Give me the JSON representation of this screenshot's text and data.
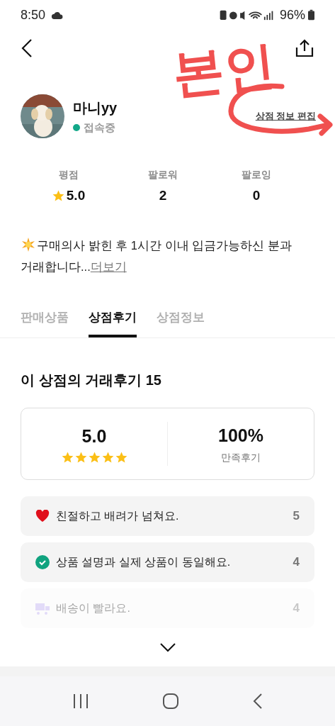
{
  "status_bar": {
    "time": "8:50",
    "battery": "96%"
  },
  "profile": {
    "name": "마니yy",
    "online": true,
    "status": "접속중",
    "edit_link": "상점 정보 편집"
  },
  "annotation": {
    "text": "본인"
  },
  "stats": [
    {
      "label": "평점",
      "value": "5.0",
      "kind": "rating"
    },
    {
      "label": "팔로워",
      "value": "2",
      "kind": "count"
    },
    {
      "label": "팔로잉",
      "value": "0",
      "kind": "count"
    }
  ],
  "bio": {
    "text": "구매의사 밝힌 후 1시간 이내 입금가능하신 분과 거래합니다...",
    "more": "더보기"
  },
  "tabs": [
    {
      "label": "판매상품",
      "selected": false
    },
    {
      "label": "상점후기",
      "selected": true
    },
    {
      "label": "상점정보",
      "selected": false
    }
  ],
  "reviews": {
    "heading": "이 상점의 거래후기 15",
    "score": "5.0",
    "stars": 5,
    "satisfaction": "100%",
    "satisfaction_label": "만족후기",
    "items": [
      {
        "kind": "heart",
        "text": "친절하고 배려가 넘쳐요.",
        "count": "5",
        "faded": false
      },
      {
        "kind": "check",
        "text": "상품 설명과 실제 상품이 동일해요.",
        "count": "4",
        "faded": false
      },
      {
        "kind": "truck",
        "text": "배송이 빨라요.",
        "count": "4",
        "faded": true
      }
    ]
  }
}
